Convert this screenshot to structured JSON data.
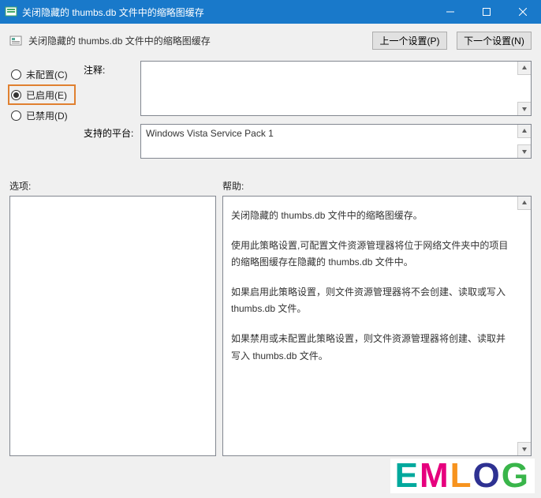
{
  "window": {
    "title": "关闭隐藏的 thumbs.db 文件中的缩略图缓存"
  },
  "header": {
    "policy_title": "关闭隐藏的 thumbs.db 文件中的缩略图缓存",
    "prev_btn": "上一个设置(P)",
    "next_btn": "下一个设置(N)"
  },
  "radios": {
    "not_configured": "未配置(C)",
    "enabled": "已启用(E)",
    "disabled": "已禁用(D)"
  },
  "fields": {
    "annotation_label": "注释:",
    "platform_label": "支持的平台:",
    "platform_value": "Windows Vista Service Pack 1"
  },
  "lower": {
    "options_label": "选项:",
    "help_label": "帮助:"
  },
  "help": {
    "p1": "关闭隐藏的 thumbs.db 文件中的缩略图缓存。",
    "p2": "使用此策略设置,可配置文件资源管理器将位于网络文件夹中的项目的缩略图缓存在隐藏的 thumbs.db 文件中。",
    "p3": "如果启用此策略设置，则文件资源管理器将不会创建、读取或写入 thumbs.db 文件。",
    "p4": "如果禁用或未配置此策略设置，则文件资源管理器将创建、读取并写入 thumbs.db 文件。"
  },
  "watermark": {
    "c1": "E",
    "c2": "M",
    "c3": "L",
    "c4": "O",
    "c5": "G"
  }
}
